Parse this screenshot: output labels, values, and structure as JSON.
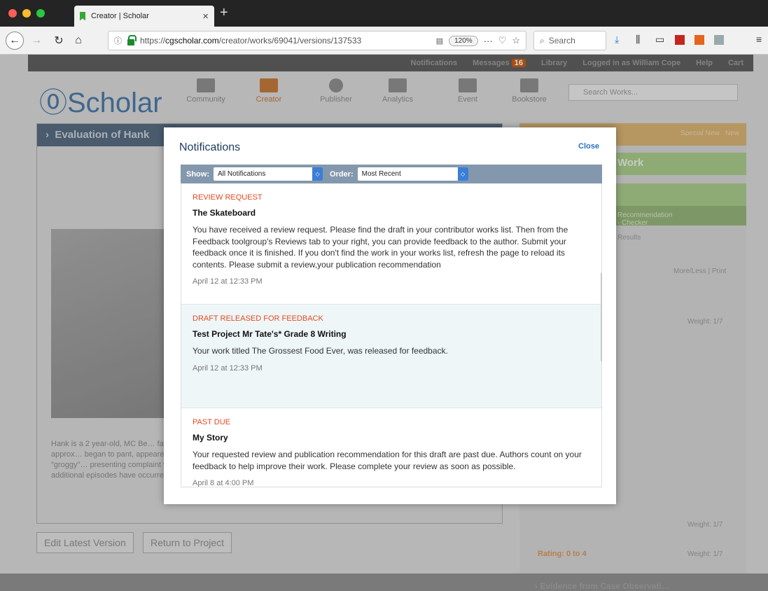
{
  "browser": {
    "tab_title": "Creator | Scholar",
    "tab_close": "×",
    "new_tab": "+",
    "url_prefix": "https://",
    "url_host": "cgscholar.com",
    "url_path": "/creator/works/69041/versions/137533",
    "zoom": "120%",
    "search_placeholder": "Search",
    "menu_dots": "···"
  },
  "site": {
    "topbar": {
      "notifications": "Notifications",
      "messages": "Messages",
      "messages_count": "16",
      "library": "Library",
      "logged_in": "Logged in as William Cope",
      "help": "Help",
      "cart": "Cart"
    },
    "logo": "Scholar",
    "nav": [
      "Community",
      "Creator",
      "Publisher",
      "Analytics",
      "Event",
      "Bookstore"
    ],
    "search_placeholder": "Search Works...",
    "left_header": "Evaluation of Hank",
    "story_text": "Hank is a 2 year-old, MC Be… fainting that occurred approx… began to pant, appeared we… while he appeared \"groggy\"… presenting complaint was co… restricted and no additional episodes have occurred.",
    "buttons": {
      "edit": "Edit Latest Version",
      "return": "Return to Project"
    },
    "right": {
      "special_new": "Special New",
      "new": "New",
      "work": "Work",
      "recommendation": "Recommendation",
      "checker": "Checker",
      "results": "Results",
      "more_less": "More/Less",
      "print": "Print",
      "weight1": "Weight: 1/7",
      "weight2": "Weight: 1/7",
      "evidence": "Evidence from Case Observati…",
      "rating": "Rating: 0 to 4",
      "weight3": "Weight: 1/7"
    }
  },
  "modal": {
    "title": "Notifications",
    "close": "Close",
    "show_label": "Show:",
    "show_value": "All Notifications",
    "order_label": "Order:",
    "order_value": "Most Recent",
    "items": [
      {
        "type": "REVIEW REQUEST",
        "title": "The Skateboard",
        "body": "You have received a review request. Please find the draft in your contributor works list. Then from the Feedback toolgroup's Reviews tab to your right, you can provide feedback to the author. Submit your feedback once it is finished. If you don't find the work in your works list, refresh the page to reload its contents. Please submit a review,your publication recommendation",
        "date": "April 12 at 12:33 PM"
      },
      {
        "type": "DRAFT RELEASED FOR FEEDBACK",
        "title": "Test Project Mr Tate's* Grade 8 Writing",
        "body": "Your work titled The Grossest Food Ever, was released for feedback.",
        "date": "April 12 at 12:33 PM"
      },
      {
        "type": "PAST DUE",
        "title": "My Story",
        "body": "Your requested review and publication recommendation for this draft are past due. Authors count on your feedback to help improve their work. Please complete your review as soon as possible.",
        "date": "April 8 at 4:00 PM"
      }
    ]
  },
  "colors": {
    "accent": "#e44a23",
    "link": "#2a6fbf",
    "filterbar": "#8498ad",
    "highlight_row": "#eef6f8"
  }
}
